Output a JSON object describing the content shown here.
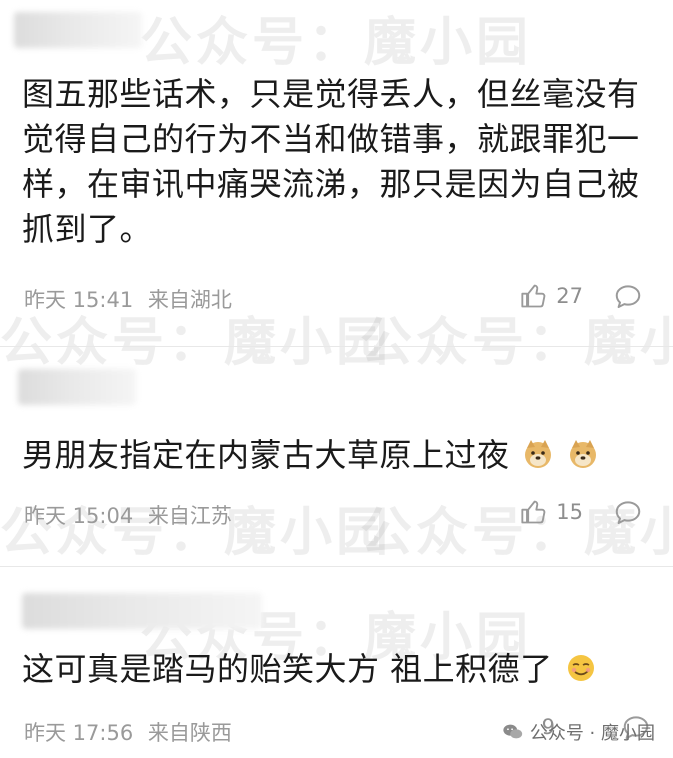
{
  "watermark": {
    "text": "公众号：魔小园"
  },
  "comments": [
    {
      "text": "图五那些话术，只是觉得丢人，但丝毫没有觉得自己的行为不当和做错事，就跟罪犯一样，在审讯中痛哭流涕，那只是因为自己被抓到了。",
      "time": "昨天 15:41",
      "location": "来自湖北",
      "likes": "27"
    },
    {
      "text": "男朋友指定在内蒙古大草原上过夜",
      "time": "昨天 15:04",
      "location": "来自江苏",
      "likes": "15",
      "emojis": [
        "doge-emoji",
        "doge-emoji"
      ]
    },
    {
      "text": "这可真是踏马的贻笑大方 祖上积德了",
      "time": "昨天 17:56",
      "location": "来自陕西",
      "likes": "9",
      "emojis": [
        "smirk-emoji"
      ]
    }
  ],
  "brand": {
    "label": "公众号 · 魔小园"
  }
}
